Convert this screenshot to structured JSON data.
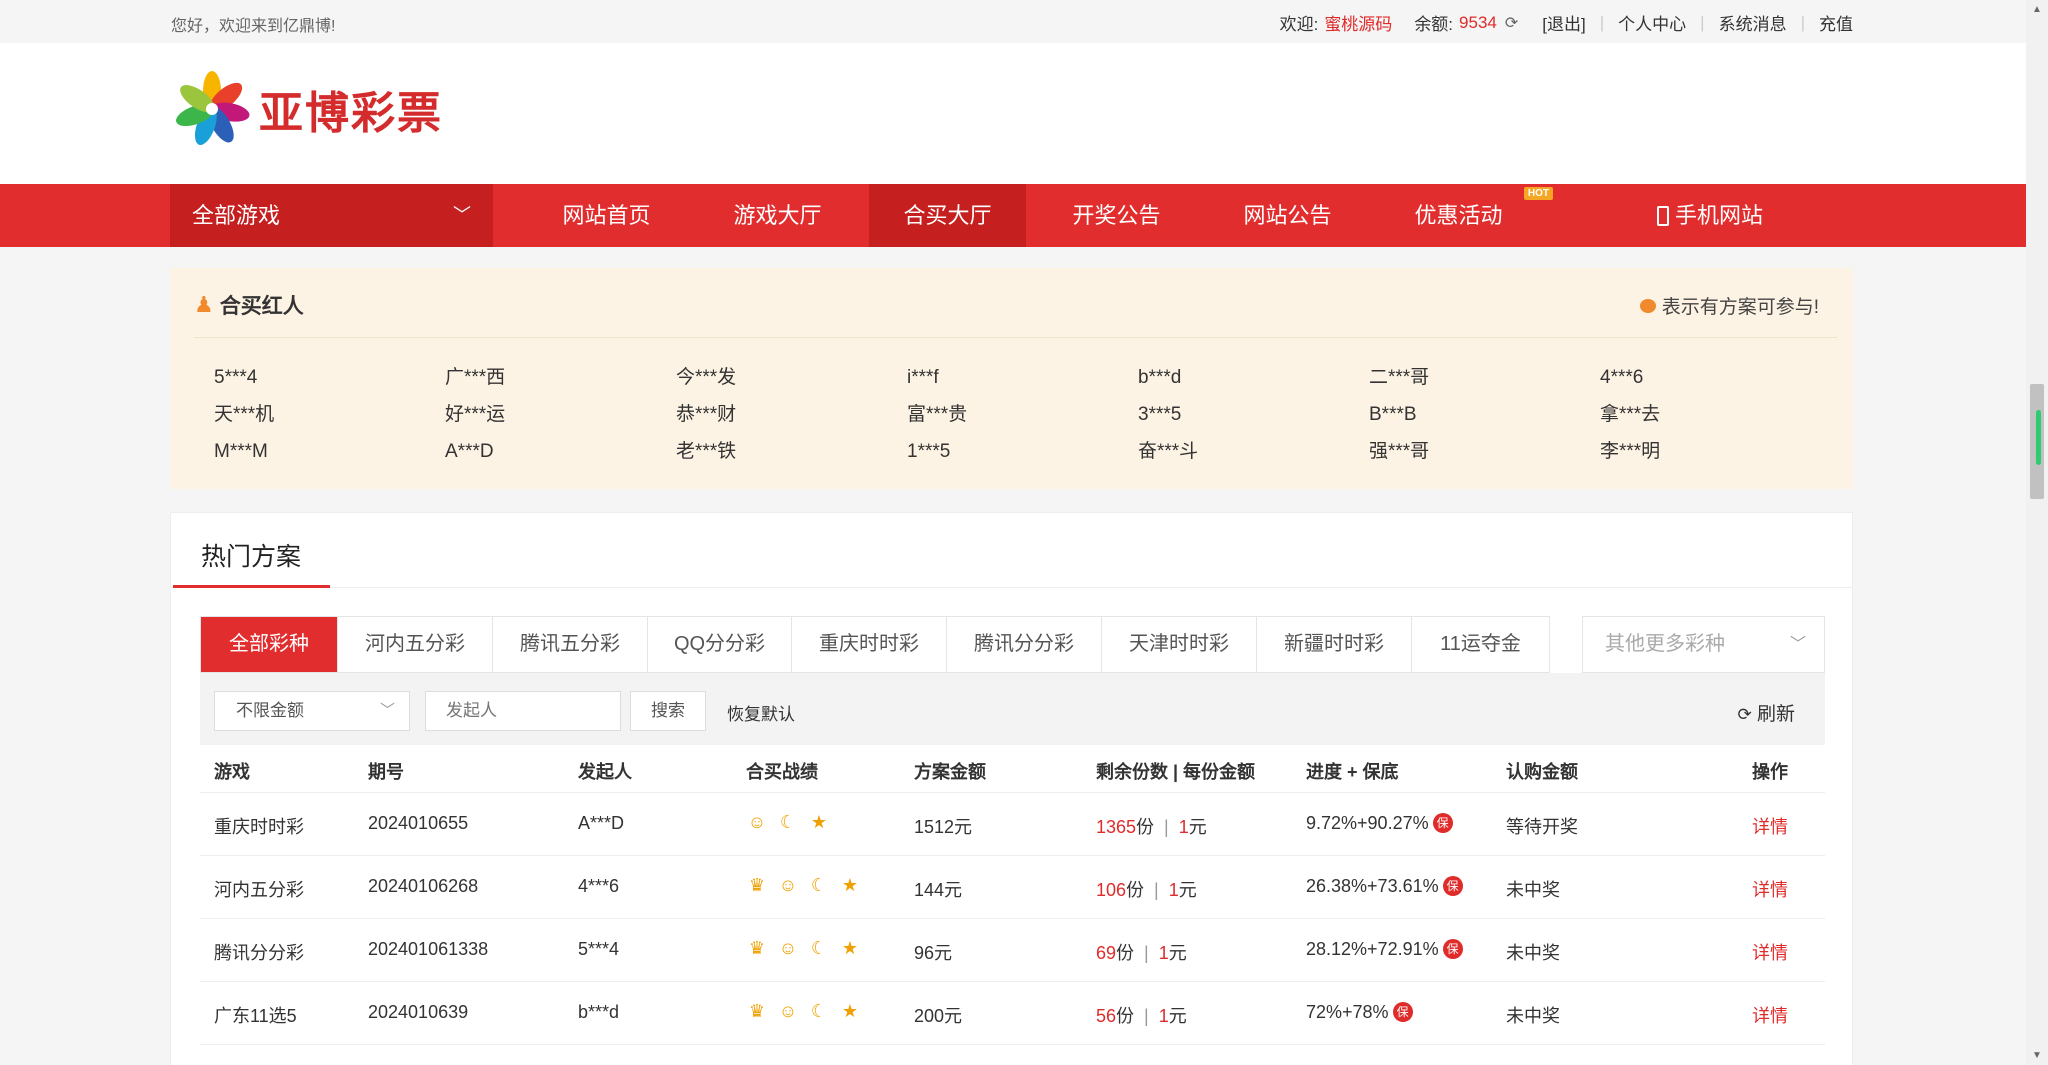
{
  "topbar": {
    "welcome": "您好，欢迎来到亿鼎博!",
    "greet_label": "欢迎:",
    "username": "蜜桃源码",
    "balance_label": "余额:",
    "balance": "9534",
    "logout": "[退出]",
    "profile": "个人中心",
    "messages": "系统消息",
    "recharge": "充值"
  },
  "logo": {
    "text": "亚博彩票"
  },
  "nav": {
    "all_games": "全部游戏",
    "items": [
      "网站首页",
      "游戏大厅",
      "合买大厅",
      "开奖公告",
      "网站公告",
      "优惠活动",
      "手机网站"
    ],
    "hot_badge": "HOT"
  },
  "hongren": {
    "title": "合买红人",
    "hint": "表示有方案可参与!",
    "names": [
      "5***4",
      "广***西",
      "今***发",
      "i***f",
      "b***d",
      "二***哥",
      "4***6",
      "天***机",
      "好***运",
      "恭***财",
      "富***贵",
      "3***5",
      "B***B",
      "拿***去",
      "M***M",
      "A***D",
      "老***铁",
      "1***5",
      "奋***斗",
      "强***哥",
      "李***明"
    ]
  },
  "hot": {
    "heading": "热门方案",
    "tabs": [
      "全部彩种",
      "河内五分彩",
      "腾讯五分彩",
      "QQ分分彩",
      "重庆时时彩",
      "腾讯分分彩",
      "天津时时彩",
      "新疆时时彩",
      "11运夺金"
    ],
    "more": "其他更多彩种",
    "filter": {
      "amount": "不限金额",
      "initiator_placeholder": "发起人",
      "search": "搜索",
      "reset": "恢复默认",
      "refresh": "刷新"
    },
    "columns": [
      "游戏",
      "期号",
      "发起人",
      "合买战绩",
      "方案金额",
      "剩余份数 | 每份金额",
      "进度 + 保底",
      "认购金额",
      "操作"
    ],
    "rows": [
      {
        "game": "重庆时时彩",
        "issue": "2024010655",
        "initiator": "A***D",
        "amount": "1512元",
        "remain": "1365",
        "per": "1",
        "progress": "9.72%+90.27%",
        "status": "等待开奖",
        "action": "详情",
        "icons": [
          "smile",
          "moon",
          "star"
        ]
      },
      {
        "game": "河内五分彩",
        "issue": "20240106268",
        "initiator": "4***6",
        "amount": "144元",
        "remain": "106",
        "per": "1",
        "progress": "26.38%+73.61%",
        "status": "未中奖",
        "action": "详情",
        "icons": [
          "crown",
          "smile",
          "moon",
          "star"
        ]
      },
      {
        "game": "腾讯分分彩",
        "issue": "202401061338",
        "initiator": "5***4",
        "amount": "96元",
        "remain": "69",
        "per": "1",
        "progress": "28.12%+72.91%",
        "status": "未中奖",
        "action": "详情",
        "icons": [
          "crown",
          "smile",
          "moon",
          "star"
        ]
      },
      {
        "game": "广东11选5",
        "issue": "2024010639",
        "initiator": "b***d",
        "amount": "200元",
        "remain": "56",
        "per": "1",
        "progress": "72%+78%",
        "status": "未中奖",
        "action": "详情",
        "icons": [
          "crown",
          "smile",
          "moon",
          "star"
        ]
      }
    ],
    "unit_fen": "份",
    "unit_yuan": "元",
    "bao": "保"
  }
}
